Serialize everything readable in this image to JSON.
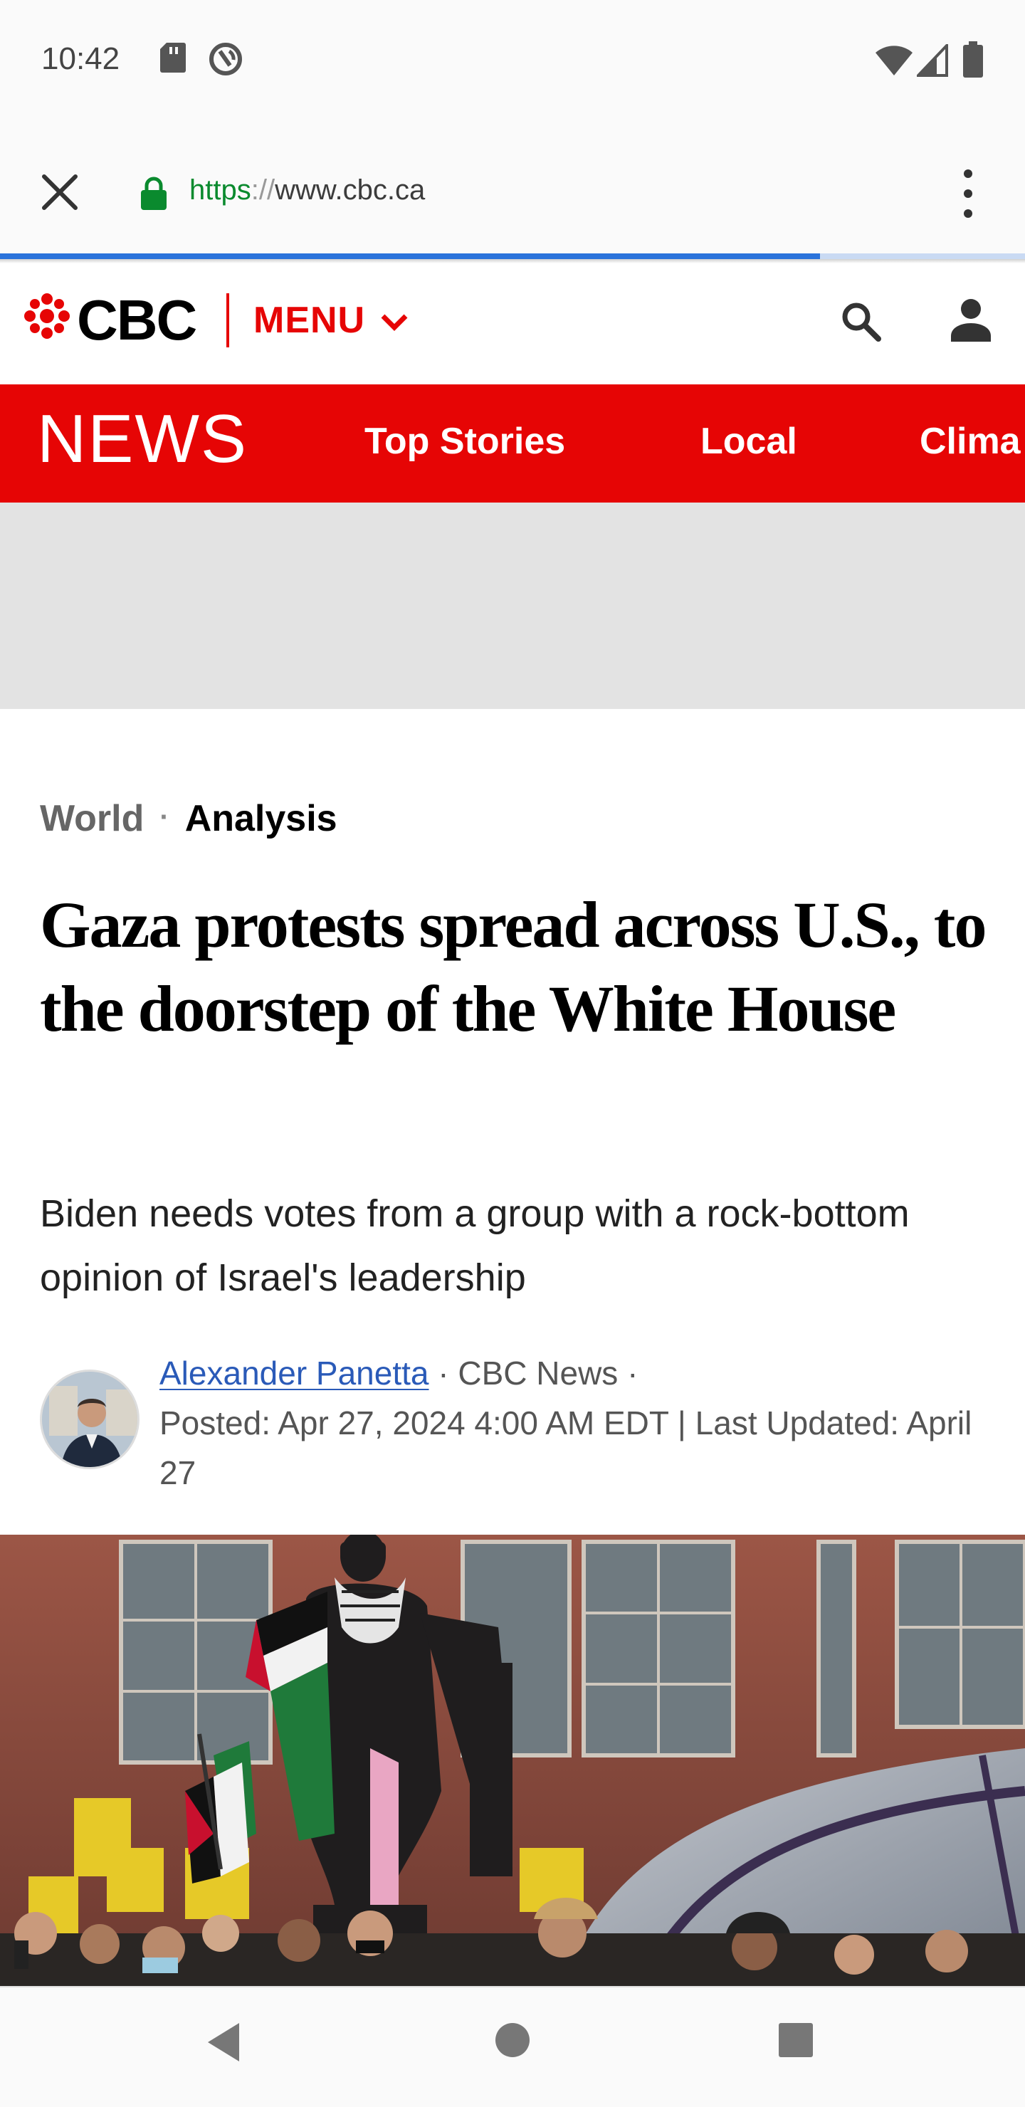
{
  "status_bar": {
    "time": "10:42"
  },
  "browser": {
    "url_scheme": "https",
    "url_sep": "://",
    "url_host": "www.cbc.ca",
    "load_progress": 0.8
  },
  "header": {
    "wordmark": "CBC",
    "menu_label": "MENU"
  },
  "news_bar": {
    "label": "NEWS",
    "tabs": [
      {
        "label": "Top Stories"
      },
      {
        "label": "Local"
      },
      {
        "label": "Clima"
      }
    ]
  },
  "article": {
    "breadcrumb": {
      "section": "World",
      "separator": "·",
      "type": "Analysis"
    },
    "headline": "Gaza protests spread across U.S., to the doorstep of the White House",
    "deck": "Biden needs votes from a group with a rock-bottom opinion of Israel's leadership",
    "byline": {
      "author": "Alexander Panetta",
      "outlet_text": " · CBC News ·",
      "posted": "Posted: Apr 27, 2024 4:00 AM EDT | Last Updated: April 27"
    }
  },
  "colors": {
    "brand_red": "#e60505",
    "link_blue": "#2a5ab8",
    "progress_blue": "#2a73db",
    "secure_green": "#0a8a2e"
  },
  "icons": {
    "sd_card": "sd-card-icon",
    "sync": "sync-icon",
    "wifi": "wifi-icon",
    "signal": "signal-icon",
    "battery": "battery-icon",
    "close": "close-icon",
    "lock": "lock-icon",
    "more": "more-vert-icon",
    "search": "search-icon",
    "account": "account-icon",
    "back": "back-icon",
    "home": "home-icon",
    "recents": "recents-icon"
  }
}
